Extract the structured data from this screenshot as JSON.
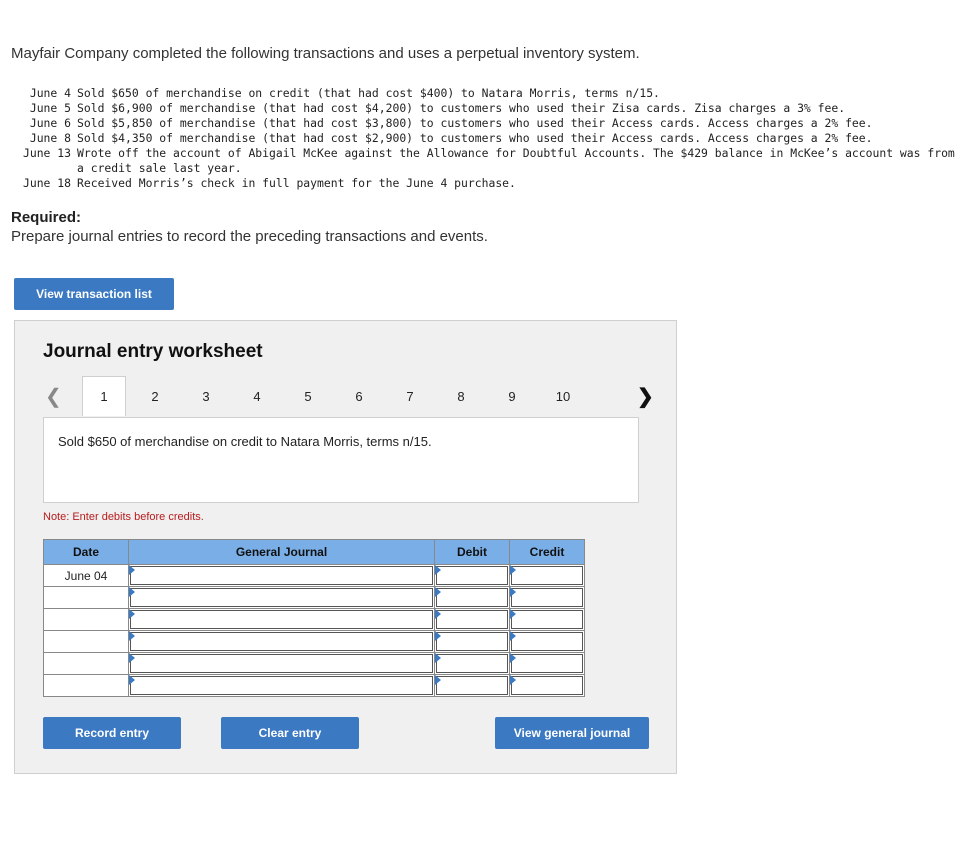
{
  "intro": "Mayfair Company completed the following transactions and uses a perpetual inventory system.",
  "transactions": [
    {
      "date": "June 4",
      "text": "Sold $650 of merchandise on credit (that had cost $400) to Natara Morris, terms n/15."
    },
    {
      "date": "June 5",
      "text": "Sold $6,900 of merchandise (that had cost $4,200) to customers who used their Zisa cards. Zisa charges a 3% fee."
    },
    {
      "date": "June 6",
      "text": "Sold $5,850 of merchandise (that had cost $3,800) to customers who used their Access cards. Access charges a 2% fee."
    },
    {
      "date": "June 8",
      "text": "Sold $4,350 of merchandise (that had cost $2,900) to customers who used their Access cards. Access charges a 2% fee."
    },
    {
      "date": "June 13",
      "text": "Wrote off the account of Abigail McKee against the Allowance for Doubtful Accounts. The $429 balance in McKee’s account was from a credit sale last year."
    },
    {
      "date": "June 18",
      "text": "Received Morris’s check in full payment for the June 4 purchase."
    }
  ],
  "required": {
    "heading": "Required:",
    "text": "Prepare journal entries to record the preceding transactions and events."
  },
  "buttons": {
    "view_transactions": "View transaction list",
    "record": "Record entry",
    "clear": "Clear entry",
    "view_journal": "View general journal"
  },
  "worksheet": {
    "title": "Journal entry worksheet",
    "pages": [
      "1",
      "2",
      "3",
      "4",
      "5",
      "6",
      "7",
      "8",
      "9",
      "10"
    ],
    "active_page": 1,
    "prev_icon": "chevron-left-icon",
    "next_icon": "chevron-right-icon",
    "description": "Sold $650 of merchandise on credit to Natara Morris, terms n/15.",
    "note": "Note: Enter debits before credits.",
    "columns": [
      "Date",
      "General Journal",
      "Debit",
      "Credit"
    ],
    "rows": [
      {
        "date": "June 04",
        "account": "",
        "debit": "",
        "credit": ""
      },
      {
        "date": "",
        "account": "",
        "debit": "",
        "credit": ""
      },
      {
        "date": "",
        "account": "",
        "debit": "",
        "credit": ""
      },
      {
        "date": "",
        "account": "",
        "debit": "",
        "credit": ""
      },
      {
        "date": "",
        "account": "",
        "debit": "",
        "credit": ""
      },
      {
        "date": "",
        "account": "",
        "debit": "",
        "credit": ""
      }
    ]
  },
  "colors": {
    "button": "#3b79c3",
    "table_header": "#7aaee6",
    "note": "#b71c1c"
  }
}
